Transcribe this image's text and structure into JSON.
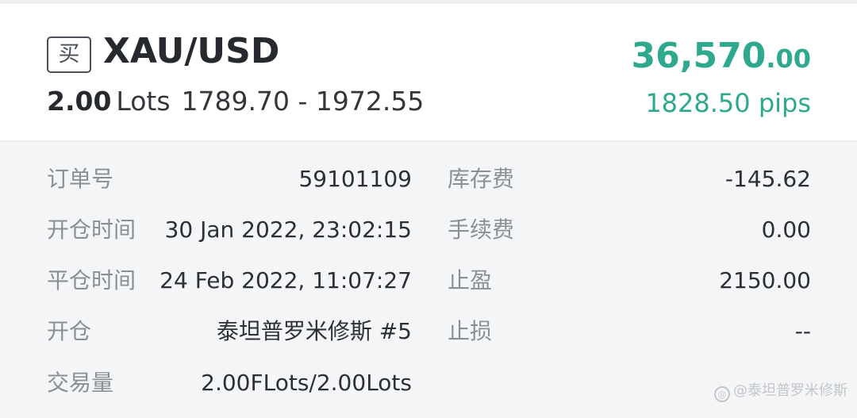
{
  "trade": {
    "side": "买",
    "symbol": "XAU/USD",
    "lots_value": "2.00",
    "lots_unit": "Lots",
    "price_range": "1789.70 - 1972.55",
    "profit_main": "36,570",
    "profit_decimals": ".00",
    "pips": "1828.50 pips"
  },
  "details": {
    "order_no_label": "订单号",
    "order_no_value": "59101109",
    "open_time_label": "开仓时间",
    "open_time_value": "30 Jan 2022, 23:02:15",
    "close_time_label": "平仓时间",
    "close_time_value": "24 Feb 2022, 11:07:27",
    "open_label": "开仓",
    "open_value": "泰坦普罗米修斯 #5",
    "volume_label": "交易量",
    "volume_value": "2.00FLots/2.00Lots",
    "swap_label": "库存费",
    "swap_value": "-145.62",
    "commission_label": "手续费",
    "commission_value": "0.00",
    "take_profit_label": "止盈",
    "take_profit_value": "2150.00",
    "stop_loss_label": "止损",
    "stop_loss_value": "--"
  },
  "watermark": {
    "icon": "weibo-icon",
    "text": "@泰坦普罗米修斯"
  },
  "colors": {
    "profit": "#2ea98e",
    "label": "#8a8f95",
    "value": "#2c3034",
    "detail_bg": "#f4f5f6"
  }
}
